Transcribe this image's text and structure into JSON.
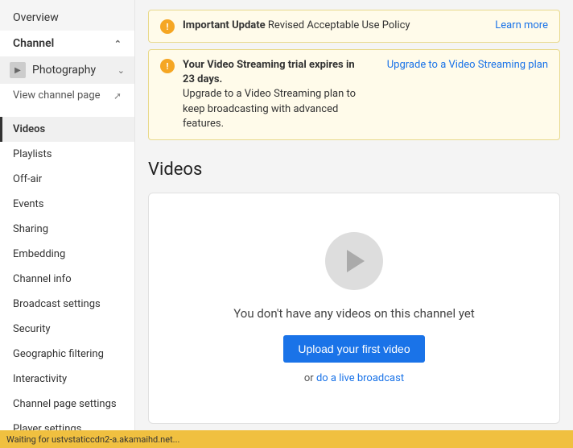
{
  "sidebar": {
    "overview_label": "Overview",
    "channel_section_label": "Channel",
    "channel_name": "Photography",
    "view_channel_label": "View channel page",
    "nav_items": [
      {
        "id": "videos",
        "label": "Videos",
        "active": true
      },
      {
        "id": "playlists",
        "label": "Playlists",
        "active": false
      },
      {
        "id": "off-air",
        "label": "Off-air",
        "active": false
      },
      {
        "id": "events",
        "label": "Events",
        "active": false
      },
      {
        "id": "sharing",
        "label": "Sharing",
        "active": false
      },
      {
        "id": "embedding",
        "label": "Embedding",
        "active": false
      },
      {
        "id": "channel-info",
        "label": "Channel info",
        "active": false
      },
      {
        "id": "broadcast-settings",
        "label": "Broadcast settings",
        "active": false
      },
      {
        "id": "security",
        "label": "Security",
        "active": false
      },
      {
        "id": "geographic-filtering",
        "label": "Geographic filtering",
        "active": false
      },
      {
        "id": "interactivity",
        "label": "Interactivity",
        "active": false
      },
      {
        "id": "channel-page-settings",
        "label": "Channel page settings",
        "active": false
      },
      {
        "id": "player-settings",
        "label": "Player settings",
        "active": false
      }
    ]
  },
  "banners": [
    {
      "id": "important-update",
      "icon_label": "!",
      "bold_text": "Important Update",
      "text": " Revised Acceptable Use Policy",
      "link_text": "Learn more",
      "link_href": "#"
    },
    {
      "id": "trial-expiry",
      "icon_label": "!",
      "bold_text": "Your Video Streaming trial expires in 23 days.",
      "text": "\nUpgrade to a Video Streaming plan to keep broadcasting with advanced features.",
      "link_text": "Upgrade to a Video Streaming plan",
      "link_href": "#"
    }
  ],
  "videos_section": {
    "title": "Videos",
    "empty_state_text": "You don't have any videos on this channel yet",
    "upload_button_label": "Upload your first video",
    "or_text": "or ",
    "live_link_text": "do a live broadcast"
  },
  "status_bar": {
    "text": "Waiting for ustvstaticcdn2-a.akamaihd.net..."
  },
  "colors": {
    "accent_blue": "#1a73e8",
    "banner_bg": "#fffbea",
    "banner_border": "#e8d98c",
    "sidebar_active_border": "#333"
  }
}
